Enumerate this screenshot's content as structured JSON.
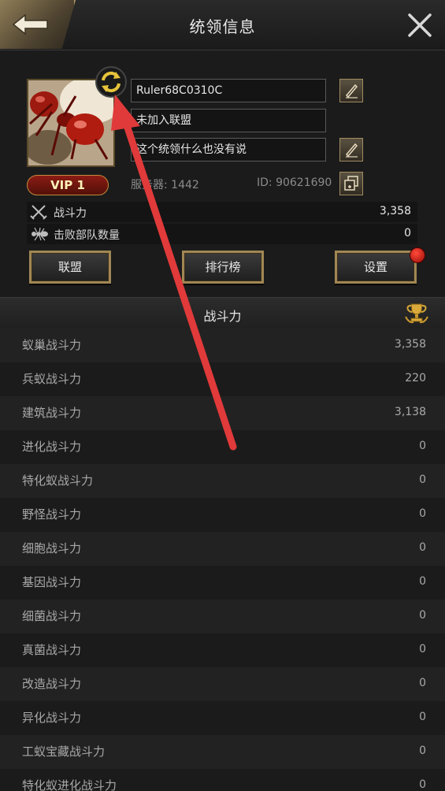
{
  "header": {
    "title": "统领信息",
    "back_icon": "back-arrow-icon",
    "close_icon": "close-icon"
  },
  "profile": {
    "name": "Ruler68C0310C",
    "alliance": "未加入联盟",
    "signature": "这个统领什么也没有说",
    "vip": "VIP 1",
    "server": "服务器: 1442",
    "id": "ID: 90621690"
  },
  "stats": [
    {
      "label": "战斗力",
      "value": "3,358",
      "icon": "crossed-swords-icon"
    },
    {
      "label": "击败部队数量",
      "value": "0",
      "icon": "ant-icon"
    }
  ],
  "buttons": {
    "alliance": "联盟",
    "ranking": "排行榜",
    "settings": "设置"
  },
  "power": {
    "title": "战斗力",
    "rows": [
      {
        "label": "蚁巢战斗力",
        "value": "3,358"
      },
      {
        "label": "兵蚁战斗力",
        "value": "220"
      },
      {
        "label": "建筑战斗力",
        "value": "3,138"
      },
      {
        "label": "进化战斗力",
        "value": "0"
      },
      {
        "label": "特化蚁战斗力",
        "value": "0"
      },
      {
        "label": "野怪战斗力",
        "value": "0"
      },
      {
        "label": "细胞战斗力",
        "value": "0"
      },
      {
        "label": "基因战斗力",
        "value": "0"
      },
      {
        "label": "细菌战斗力",
        "value": "0"
      },
      {
        "label": "真菌战斗力",
        "value": "0"
      },
      {
        "label": "改造战斗力",
        "value": "0"
      },
      {
        "label": "异化战斗力",
        "value": "0"
      },
      {
        "label": "工蚁宝藏战斗力",
        "value": "0"
      },
      {
        "label": "特化蚁进化战斗力",
        "value": "0"
      }
    ]
  },
  "colors": {
    "gold_border": "#a18754",
    "annotation_arrow": "#e03a3a",
    "background": "#1b1b1b"
  }
}
